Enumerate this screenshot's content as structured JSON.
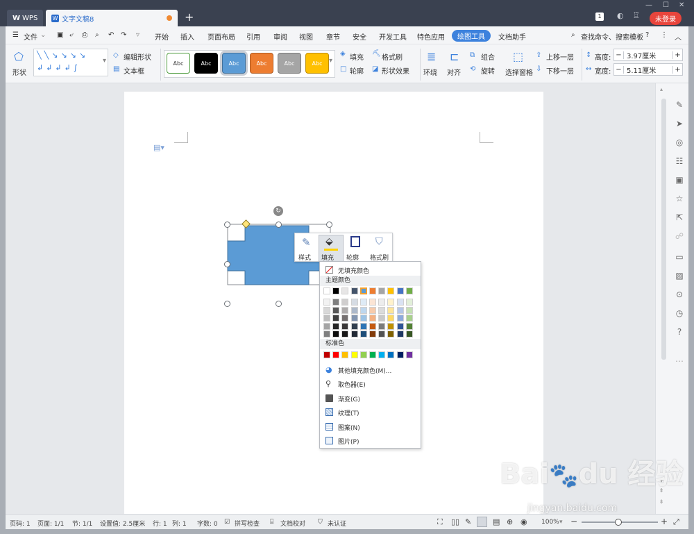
{
  "window": {
    "wps_tab": "WPS",
    "doc_tab": "文字文稿8",
    "login_button": "未登录",
    "badge": "1"
  },
  "menu": {
    "file": "文件",
    "items": [
      "开始",
      "插入",
      "页面布局",
      "引用",
      "审阅",
      "视图",
      "章节",
      "安全",
      "开发工具",
      "特色应用"
    ],
    "active": "绘图工具",
    "after": "文档助手",
    "search": "查找命令、搜索模板"
  },
  "ribbon": {
    "shape": "形状",
    "edit_shape": "编辑形状",
    "text_box": "文本框",
    "styles": [
      {
        "label": "Abc",
        "bg": "#ffffff",
        "fg": "#333333",
        "border": "#4a9a3a"
      },
      {
        "label": "Abc",
        "bg": "#000000",
        "fg": "#ffffff",
        "border": "#000000"
      },
      {
        "label": "Abc",
        "bg": "#5b9bd5",
        "fg": "#ffffff",
        "border": "#41719c"
      },
      {
        "label": "Abc",
        "bg": "#ed7d31",
        "fg": "#ffffff",
        "border": "#ae5a21"
      },
      {
        "label": "Abc",
        "bg": "#a5a5a5",
        "fg": "#ffffff",
        "border": "#787878"
      },
      {
        "label": "Abc",
        "bg": "#ffc000",
        "fg": "#ffffff",
        "border": "#bc8c00"
      }
    ],
    "fill": "填充",
    "format_painter": "格式刷",
    "outline": "轮廓",
    "shape_effects": "形状效果",
    "wrap": "环绕",
    "align": "对齐",
    "group": "组合",
    "rotate": "旋转",
    "selection_pane": "选择窗格",
    "bring_forward": "上移一层",
    "send_backward": "下移一层",
    "height_label": "高度:",
    "height_value": "3.97厘米",
    "width_label": "宽度:",
    "width_value": "5.11厘米"
  },
  "floatbar": {
    "style": "样式",
    "fill": "填充",
    "outline": "轮廓",
    "painter": "格式刷"
  },
  "dropdown": {
    "no_fill": "无填充颜色",
    "theme_header": "主题颜色",
    "theme_top": [
      "#ffffff",
      "#000000",
      "#e7e6e6",
      "#44546a",
      "#5b9bd5",
      "#ed7d31",
      "#a5a5a5",
      "#ffc000",
      "#4472c4",
      "#70ad47"
    ],
    "theme_shades": [
      [
        "#f2f2f2",
        "#7f7f7f",
        "#d0cece",
        "#d6dce4",
        "#deebf6",
        "#fbe5d5",
        "#ededed",
        "#fff2cc",
        "#d9e2f3",
        "#e2efd9"
      ],
      [
        "#d8d8d8",
        "#595959",
        "#aeabab",
        "#adb9ca",
        "#bdd7ee",
        "#f7cbac",
        "#dbdbdb",
        "#fee599",
        "#b4c6e7",
        "#c5e0b3"
      ],
      [
        "#bfbfbf",
        "#3f3f3f",
        "#757070",
        "#8496b0",
        "#9cc3e5",
        "#f4b183",
        "#c9c9c9",
        "#ffd965",
        "#8eaadb",
        "#a8d08d"
      ],
      [
        "#a5a5a5",
        "#262626",
        "#3a3838",
        "#323f4f",
        "#2e75b5",
        "#c55a11",
        "#7b7b7b",
        "#bf9000",
        "#2f5496",
        "#538135"
      ],
      [
        "#7f7f7f",
        "#0c0c0c",
        "#171616",
        "#222a35",
        "#1f4e79",
        "#833c0b",
        "#525252",
        "#7f6000",
        "#1f3864",
        "#375623"
      ]
    ],
    "standard_header": "标准色",
    "standard": [
      "#c00000",
      "#ff0000",
      "#ffc000",
      "#ffff00",
      "#92d050",
      "#00b050",
      "#00b0f0",
      "#0070c0",
      "#002060",
      "#7030a0"
    ],
    "more_colors": "其他填充颜色(M)...",
    "eyedropper": "取色器(E)",
    "gradient": "渐变(G)",
    "texture": "纹理(T)",
    "pattern": "图案(N)",
    "picture": "图片(P)"
  },
  "shape": {
    "fill_color": "#5b9bd5",
    "stroke": "#41719c"
  },
  "status": {
    "page": "页码: 1",
    "pages": "页面: 1/1",
    "section": "节: 1/1",
    "setting": "设置值: 2.5厘米",
    "row": "行: 1",
    "col": "列: 1",
    "words": "字数: 0",
    "spell": "拼写检查",
    "proof": "文档校对",
    "cert": "未认证",
    "zoom": "100%"
  },
  "watermark": "jingyan.baidu.com"
}
